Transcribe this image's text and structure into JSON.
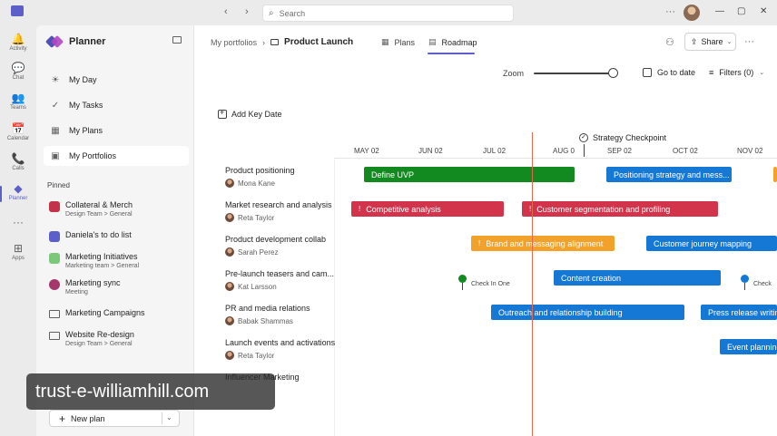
{
  "rail": {
    "items": [
      {
        "icon": "🔔",
        "label": "Activity"
      },
      {
        "icon": "💬",
        "label": "Chat"
      },
      {
        "icon": "👥",
        "label": "Teams"
      },
      {
        "icon": "📅",
        "label": "Calendar"
      },
      {
        "icon": "📞",
        "label": "Calls"
      },
      {
        "icon": "◆",
        "label": "Planner"
      },
      {
        "icon": "···",
        "label": ""
      },
      {
        "icon": "⊞",
        "label": "Apps"
      }
    ]
  },
  "topbar": {
    "back": "‹",
    "forward": "›",
    "search_placeholder": "Search",
    "more": "···",
    "window": [
      "—",
      "▢",
      "✕"
    ]
  },
  "panel": {
    "title": "Planner",
    "nav": [
      {
        "icon": "☀",
        "label": "My Day"
      },
      {
        "icon": "✓",
        "label": "My Tasks"
      },
      {
        "icon": "▦",
        "label": "My Plans"
      },
      {
        "icon": "▣",
        "label": "My Portfolios"
      }
    ],
    "pinned_label": "Pinned",
    "pinned": [
      {
        "title": "Collateral & Merch",
        "subtitle": "Design Team > General",
        "color": "#c4314b"
      },
      {
        "title": "Daniela's to do list",
        "subtitle": "",
        "color": "#5b5fc7"
      },
      {
        "title": "Marketing Initiatives",
        "subtitle": "Marketing team > General",
        "color": "#7bc87b"
      },
      {
        "title": "Marketing sync",
        "subtitle": "Meeting",
        "color": "#a4376b"
      },
      {
        "title": "Marketing Campaigns",
        "subtitle": "",
        "color": ""
      },
      {
        "title": "Website Re-design",
        "subtitle": "Design Team > General",
        "color": ""
      }
    ],
    "new_plan": "New plan"
  },
  "main": {
    "breadcrumb_root": "My portfolios",
    "breadcrumb_current": "Product Launch",
    "tabs": [
      {
        "icon": "▦",
        "label": "Plans"
      },
      {
        "icon": "▤",
        "label": "Roadmap"
      }
    ],
    "share": "Share",
    "more": "···",
    "zoom": "Zoom",
    "zoom_level": 1.0,
    "go_to_date": "Go to date",
    "filters": "Filters (0)",
    "add_key_date": "Add Key Date",
    "checkpoint": "Strategy Checkpoint",
    "months": [
      "MAY 02",
      "JUN 02",
      "JUL 02",
      "AUG 0",
      "SEP 02",
      "OCT 02",
      "NOV 02"
    ],
    "rows": [
      {
        "title": "Product positioning",
        "owner": "Mona Kane"
      },
      {
        "title": "Market research and analysis",
        "owner": "Reta Taylor"
      },
      {
        "title": "Product development collab",
        "owner": "Sarah Perez"
      },
      {
        "title": "Pre-launch teasers and cam...",
        "owner": "Kat Larsson"
      },
      {
        "title": "PR and media relations",
        "owner": "Babak Shammas"
      },
      {
        "title": "Launch events and activations",
        "owner": "Reta Taylor"
      },
      {
        "title": "Influencer Marketing",
        "owner": ""
      }
    ],
    "bars": {
      "r0a": "Define UVP",
      "r0b": "Positioning strategy and mess...",
      "r1a": "Competitive analysis",
      "r1b": "Customer segmentation and profiling",
      "r2a": "Brand and messaging alignment",
      "r2b": "Customer journey mapping",
      "r3a": "Content creation",
      "r4a": "Outreach and relationship building",
      "r4b": "Press release writing",
      "r5a": "Event planning"
    },
    "milestones": {
      "m1": "Check In One",
      "m2": "Check"
    },
    "colors": {
      "green": "#138a1f",
      "blue": "#1478d4",
      "red": "#d1344b",
      "orange": "#f2a22a",
      "accent": "#5b5fc7",
      "today": "#e4684c"
    }
  },
  "watermark": "trust-e-williamhill.com"
}
